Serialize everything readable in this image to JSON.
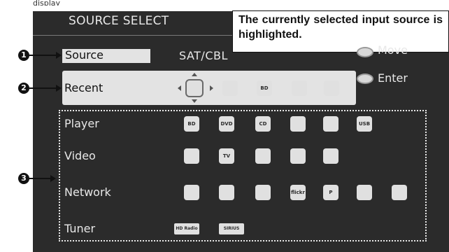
{
  "top_clip": "display",
  "title": "SOURCE SELECT",
  "caption": "The currently selected input source is highlighted.",
  "callouts": [
    "1",
    "2",
    "3"
  ],
  "source": {
    "label": "Source",
    "value": "SAT/CBL"
  },
  "legend": {
    "move": "Move",
    "enter": "Enter"
  },
  "recent": {
    "label": "Recent",
    "icons": [
      {
        "name": "satellite-dish-icon",
        "text": ""
      },
      {
        "name": "media-player-icon",
        "text": ""
      },
      {
        "name": "bluray-disc-icon",
        "text": "BD"
      },
      {
        "name": "internet-radio-icon",
        "text": ""
      },
      {
        "name": "game-controller-icon",
        "text": ""
      }
    ]
  },
  "rows": [
    {
      "label": "Player",
      "icons": [
        {
          "name": "bluray-disc-icon",
          "text": "BD"
        },
        {
          "name": "dvd-disc-icon",
          "text": "DVD"
        },
        {
          "name": "cd-disc-icon",
          "text": "CD"
        },
        {
          "name": "phono-icon",
          "text": ""
        },
        {
          "name": "media-player-icon",
          "text": ""
        },
        {
          "name": "usb-icon",
          "text": "USB"
        }
      ]
    },
    {
      "label": "Video",
      "icons": [
        {
          "name": "satellite-dish-icon",
          "text": ""
        },
        {
          "name": "tv-icon",
          "text": "TV"
        },
        {
          "name": "blu-ray-player-icon",
          "text": ""
        },
        {
          "name": "game-icon",
          "text": ""
        },
        {
          "name": "aux-icon",
          "text": ""
        }
      ]
    },
    {
      "label": "Network",
      "icons": [
        {
          "name": "favorites-icon",
          "text": ""
        },
        {
          "name": "internet-radio-icon",
          "text": ""
        },
        {
          "name": "media-server-icon",
          "text": ""
        },
        {
          "name": "flickr-icon",
          "text": "flickr"
        },
        {
          "name": "pandora-icon",
          "text": "P"
        },
        {
          "name": "siriusxm-internet-icon",
          "text": ""
        },
        {
          "name": "spotify-icon",
          "text": ""
        }
      ]
    },
    {
      "label": "Tuner",
      "icons": [
        {
          "name": "hd-radio-icon",
          "text": "HD Radio"
        },
        {
          "name": "sirius-icon",
          "text": "SIRIUS"
        }
      ]
    }
  ]
}
